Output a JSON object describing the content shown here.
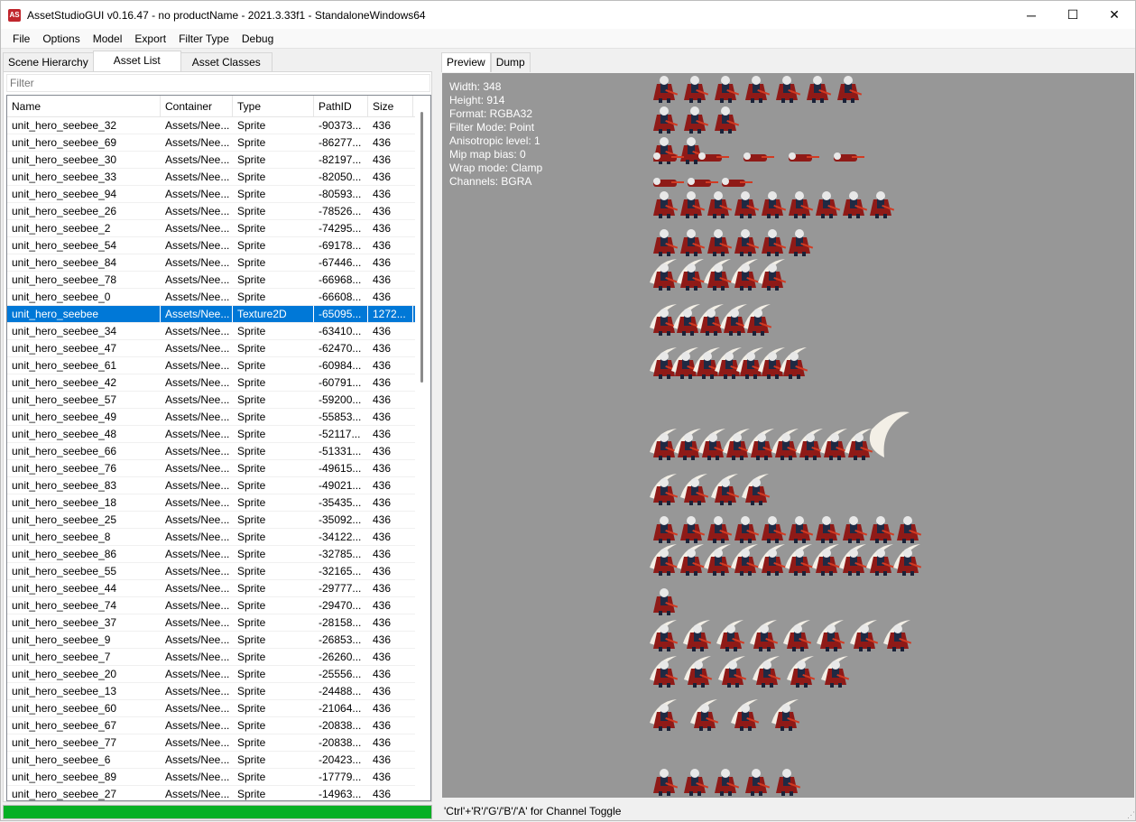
{
  "window": {
    "icon": "AS",
    "title": "AssetStudioGUI v0.16.47 - no productName - 2021.3.33f1 - StandaloneWindows64",
    "minimize": "─",
    "maximize": "☐",
    "close": "✕"
  },
  "menu": [
    "File",
    "Options",
    "Model",
    "Export",
    "Filter Type",
    "Debug"
  ],
  "left_tabs": [
    "Scene Hierarchy",
    "Asset List",
    "Asset Classes"
  ],
  "filter_placeholder": "Filter",
  "columns": [
    "Name",
    "Container",
    "Type",
    "PathID",
    "Size"
  ],
  "rows": [
    [
      "unit_hero_seebee_32",
      "Assets/Nee...",
      "Sprite",
      "-90373...",
      "436"
    ],
    [
      "unit_hero_seebee_69",
      "Assets/Nee...",
      "Sprite",
      "-86277...",
      "436"
    ],
    [
      "unit_hero_seebee_30",
      "Assets/Nee...",
      "Sprite",
      "-82197...",
      "436"
    ],
    [
      "unit_hero_seebee_33",
      "Assets/Nee...",
      "Sprite",
      "-82050...",
      "436"
    ],
    [
      "unit_hero_seebee_94",
      "Assets/Nee...",
      "Sprite",
      "-80593...",
      "436"
    ],
    [
      "unit_hero_seebee_26",
      "Assets/Nee...",
      "Sprite",
      "-78526...",
      "436"
    ],
    [
      "unit_hero_seebee_2",
      "Assets/Nee...",
      "Sprite",
      "-74295...",
      "436"
    ],
    [
      "unit_hero_seebee_54",
      "Assets/Nee...",
      "Sprite",
      "-69178...",
      "436"
    ],
    [
      "unit_hero_seebee_84",
      "Assets/Nee...",
      "Sprite",
      "-67446...",
      "436"
    ],
    [
      "unit_hero_seebee_78",
      "Assets/Nee...",
      "Sprite",
      "-66968...",
      "436"
    ],
    [
      "unit_hero_seebee_0",
      "Assets/Nee...",
      "Sprite",
      "-66608...",
      "436"
    ],
    [
      "unit_hero_seebee",
      "Assets/Nee...",
      "Texture2D",
      "-65095...",
      "1272..."
    ],
    [
      "unit_hero_seebee_34",
      "Assets/Nee...",
      "Sprite",
      "-63410...",
      "436"
    ],
    [
      "unit_hero_seebee_47",
      "Assets/Nee...",
      "Sprite",
      "-62470...",
      "436"
    ],
    [
      "unit_hero_seebee_61",
      "Assets/Nee...",
      "Sprite",
      "-60984...",
      "436"
    ],
    [
      "unit_hero_seebee_42",
      "Assets/Nee...",
      "Sprite",
      "-60791...",
      "436"
    ],
    [
      "unit_hero_seebee_57",
      "Assets/Nee...",
      "Sprite",
      "-59200...",
      "436"
    ],
    [
      "unit_hero_seebee_49",
      "Assets/Nee...",
      "Sprite",
      "-55853...",
      "436"
    ],
    [
      "unit_hero_seebee_48",
      "Assets/Nee...",
      "Sprite",
      "-52117...",
      "436"
    ],
    [
      "unit_hero_seebee_66",
      "Assets/Nee...",
      "Sprite",
      "-51331...",
      "436"
    ],
    [
      "unit_hero_seebee_76",
      "Assets/Nee...",
      "Sprite",
      "-49615...",
      "436"
    ],
    [
      "unit_hero_seebee_83",
      "Assets/Nee...",
      "Sprite",
      "-49021...",
      "436"
    ],
    [
      "unit_hero_seebee_18",
      "Assets/Nee...",
      "Sprite",
      "-35435...",
      "436"
    ],
    [
      "unit_hero_seebee_25",
      "Assets/Nee...",
      "Sprite",
      "-35092...",
      "436"
    ],
    [
      "unit_hero_seebee_8",
      "Assets/Nee...",
      "Sprite",
      "-34122...",
      "436"
    ],
    [
      "unit_hero_seebee_86",
      "Assets/Nee...",
      "Sprite",
      "-32785...",
      "436"
    ],
    [
      "unit_hero_seebee_55",
      "Assets/Nee...",
      "Sprite",
      "-32165...",
      "436"
    ],
    [
      "unit_hero_seebee_44",
      "Assets/Nee...",
      "Sprite",
      "-29777...",
      "436"
    ],
    [
      "unit_hero_seebee_74",
      "Assets/Nee...",
      "Sprite",
      "-29470...",
      "436"
    ],
    [
      "unit_hero_seebee_37",
      "Assets/Nee...",
      "Sprite",
      "-28158...",
      "436"
    ],
    [
      "unit_hero_seebee_9",
      "Assets/Nee...",
      "Sprite",
      "-26853...",
      "436"
    ],
    [
      "unit_hero_seebee_7",
      "Assets/Nee...",
      "Sprite",
      "-26260...",
      "436"
    ],
    [
      "unit_hero_seebee_20",
      "Assets/Nee...",
      "Sprite",
      "-25556...",
      "436"
    ],
    [
      "unit_hero_seebee_13",
      "Assets/Nee...",
      "Sprite",
      "-24488...",
      "436"
    ],
    [
      "unit_hero_seebee_60",
      "Assets/Nee...",
      "Sprite",
      "-21064...",
      "436"
    ],
    [
      "unit_hero_seebee_67",
      "Assets/Nee...",
      "Sprite",
      "-20838...",
      "436"
    ],
    [
      "unit_hero_seebee_77",
      "Assets/Nee...",
      "Sprite",
      "-20838...",
      "436"
    ],
    [
      "unit_hero_seebee_6",
      "Assets/Nee...",
      "Sprite",
      "-20423...",
      "436"
    ],
    [
      "unit_hero_seebee_89",
      "Assets/Nee...",
      "Sprite",
      "-17779...",
      "436"
    ],
    [
      "unit_hero_seebee_27",
      "Assets/Nee...",
      "Sprite",
      "-14963...",
      "436"
    ]
  ],
  "selected_row": 11,
  "progress_percent": 100,
  "right_tabs": [
    "Preview",
    "Dump"
  ],
  "preview_info": [
    "Width: 348",
    "Height: 914",
    "Format: RGBA32",
    "Filter Mode: Point",
    "Anisotropic level: 1",
    "Mip map bias: 0",
    "Wrap mode: Clamp",
    "Channels: BGRA"
  ],
  "status_text": "'Ctrl'+'R'/'G'/'B'/'A' for Channel Toggle",
  "colors": {
    "selection": "#0078d7",
    "progress": "#06b025",
    "preview_bg": "#979797",
    "sprite_cloak": "#8f1a17",
    "sprite_hair": "#e8e8e8"
  }
}
